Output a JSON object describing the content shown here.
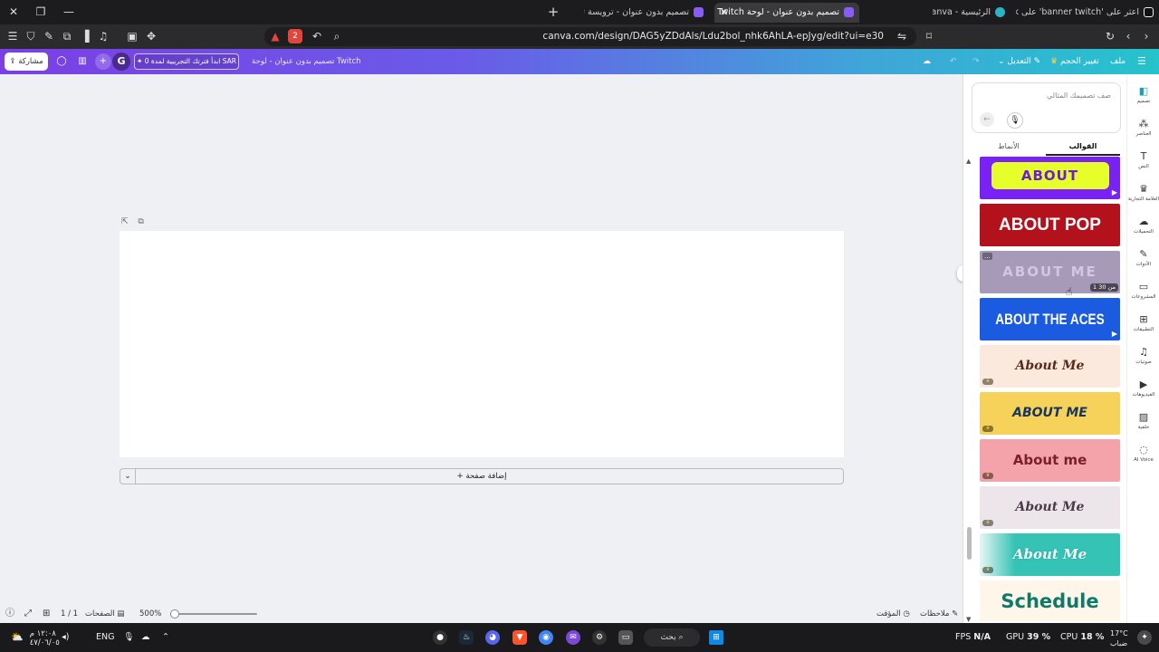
{
  "browser": {
    "tabs": [
      {
        "title": "اعثر على 'banner twitch' على TikTok",
        "color": "#ffffff"
      },
      {
        "title": "الرئيسية - Canva",
        "color": "#2bb3c6"
      },
      {
        "title": "تصميم بدون عنوان - لوحة Twitch",
        "color": "#8a5cf6"
      },
      {
        "title": "تصميم بدون عنوان - ترويسة تويتر",
        "color": "#8a5cf6"
      }
    ],
    "new_tab": "+",
    "tab_close": "✕",
    "url": "canva.com/design/DAG5yZDdAls/Ldu2bol_nhk6AhLA-epJyg/edit?ui=e30",
    "brave_badge": "2"
  },
  "canva_bar": {
    "file": "ملف",
    "resize": "تغيير الحجم",
    "edit": "التعديل",
    "doc_title": "تصميم بدون عنوان - لوحة Twitch",
    "trial": "ابدأ فترتك التجريبية لمدة 0 SAR",
    "avatar": "G",
    "share": "مشاركة"
  },
  "editor": {
    "add_page": "+ إضافة صفحة"
  },
  "bottom_bar": {
    "notes": "ملاحظات",
    "timer": "المؤقت",
    "zoom": "500%",
    "zoom_level": 0.05,
    "pages": "الصفحات",
    "page_count": "1 / 1"
  },
  "panel": {
    "prompt_placeholder": "صف تصميمك المثالي",
    "tabs": [
      "القوالب",
      "الأنماط"
    ],
    "active_tab": 0,
    "templates": [
      {
        "text": "ABOUT",
        "bg": "#7a22f5",
        "fg": "#e6ff2a",
        "style": "pill",
        "play": true
      },
      {
        "text": "ABOUT POP",
        "bg": "#b3121d",
        "fg": "#ffffff",
        "style": "bold",
        "play": false
      },
      {
        "text": "ABOUT ME",
        "bg": "#a79ab8",
        "fg": "#d3c6e4",
        "style": "soft",
        "pager": "1 من 30",
        "more": "..."
      },
      {
        "text": "ABOUT THE ACES",
        "bg": "#1b5be0",
        "fg": "#ffffff",
        "style": "condensed",
        "play": true
      },
      {
        "text": "About Me",
        "bg": "#fbe9de",
        "fg": "#5a2a1a",
        "style": "script",
        "crown": true
      },
      {
        "text": "ABOUT ME",
        "bg": "#f7d25a",
        "fg": "#17365d",
        "style": "italic",
        "crown": true
      },
      {
        "text": "About me",
        "bg": "#f5a3aa",
        "fg": "#7a1f2b",
        "style": "rounded",
        "crown": true
      },
      {
        "text": "About Me",
        "bg": "#ece6ea",
        "fg": "#4a3a4a",
        "style": "script",
        "crown": true
      },
      {
        "text": "About Me",
        "bg": "#e8f6f4",
        "fg": "#ffffff",
        "style": "teal",
        "crown": true
      },
      {
        "text": "Schedule",
        "bg": "#fff6ea",
        "fg": "#0e7a6a",
        "style": "heavy",
        "crown": false
      }
    ]
  },
  "rail": [
    {
      "icon": "design-icon",
      "glyph": "◧",
      "label": "تصميم"
    },
    {
      "icon": "elements-icon",
      "glyph": "⁂",
      "label": "العناصر"
    },
    {
      "icon": "text-icon",
      "glyph": "T",
      "label": "النص"
    },
    {
      "icon": "brand-icon",
      "glyph": "♛",
      "label": "العلامة التجارية"
    },
    {
      "icon": "uploads-icon",
      "glyph": "☁",
      "label": "التحميلات"
    },
    {
      "icon": "tools-icon",
      "glyph": "✎",
      "label": "الأدوات"
    },
    {
      "icon": "projects-icon",
      "glyph": "▭",
      "label": "المشروعات"
    },
    {
      "icon": "apps-icon",
      "glyph": "⊞",
      "label": "التطبيقات"
    },
    {
      "icon": "audio-icon",
      "glyph": "♫",
      "label": "صوتيات"
    },
    {
      "icon": "videos-icon",
      "glyph": "▶",
      "label": "الفيديوهات"
    },
    {
      "icon": "background-icon",
      "glyph": "▨",
      "label": "خلفية"
    },
    {
      "icon": "ai-voice-icon",
      "glyph": "◌",
      "label": "AI Voice"
    }
  ],
  "taskbar": {
    "search": "بحث",
    "fps_label": "FPS",
    "fps_value": "N/A",
    "gpu_label": "GPU",
    "gpu_value": "39 %",
    "cpu_label": "CPU",
    "cpu_value": "18 %",
    "weather_temp": "17°C",
    "weather_text": "ضباب",
    "lang": "ENG",
    "time": "١٢:٠٨ م",
    "date": "٤٧/٠٦/٠٥"
  }
}
